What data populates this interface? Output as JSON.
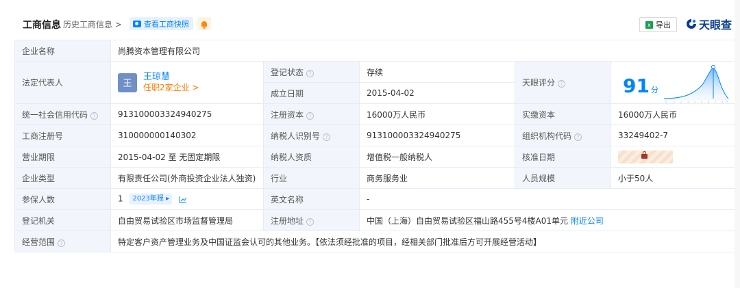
{
  "header": {
    "title": "工商信息",
    "history_link": "历史工商信息 >",
    "snapshot_button": "查看工商快照",
    "export_button": "导出",
    "brand": "天眼查"
  },
  "icons": {
    "snapshot": "camera-icon",
    "alert": "bell-icon",
    "export": "excel-icon",
    "brand": "tianyancha-logo-icon",
    "help": "question-circle-icon",
    "trend": "trend-chart-icon",
    "locked": "lock-icon"
  },
  "colors": {
    "accent": "#0084ff",
    "status_green": "#14a14e",
    "label_bg": "#f2f6fc",
    "orange": "#ff7a00"
  },
  "fields": {
    "company_name_label": "企业名称",
    "company_name": "尚腾资本管理有限公司",
    "legal_rep_label": "法定代表人",
    "legal_rep_avatar": "王",
    "legal_rep_name": "王琼慧",
    "legal_rep_jobs": "任职2家企业 >",
    "reg_status_label": "登记状态",
    "reg_status": "存续",
    "found_date_label": "成立日期",
    "found_date": "2015-04-02",
    "score_label": "天眼评分",
    "score_value": "91",
    "score_unit": "分",
    "credit_code_label": "统一社会信用代码",
    "credit_code": "913100003324940275",
    "reg_capital_label": "注册资本",
    "reg_capital": "16000万人民币",
    "paid_capital_label": "实缴资本",
    "paid_capital": "16000万人民币",
    "reg_no_label": "工商注册号",
    "reg_no": "310000000140302",
    "tax_id_label": "纳税人识别号",
    "tax_id": "913100003324940275",
    "org_code_label": "组织机构代码",
    "org_code": "33249402-7",
    "term_label": "营业期限",
    "term": "2015-04-02 至 无固定期限",
    "taxpayer_label": "纳税人资质",
    "taxpayer": "增值税一般纳税人",
    "approve_date_label": "核准日期",
    "type_label": "企业类型",
    "type": "有限责任公司(外商投资企业法人独资)",
    "industry_label": "行业",
    "industry": "商务服务业",
    "staff_label": "人员规模",
    "staff": "小于50人",
    "insured_label": "参保人数",
    "insured": "1",
    "insured_badge": "2023年报 ▸",
    "english_label": "英文名称",
    "english": "-",
    "authority_label": "登记机关",
    "authority": "自由贸易试验区市场监督管理局",
    "address_label": "注册地址",
    "address": "中国（上海）自由贸易试验区福山路455号4楼A01单元",
    "nearby_link": "附近公司",
    "scope_label": "经营范围",
    "scope": "特定客户资产管理业务及中国证监会认可的其他业务。【依法须经批准的项目，经相关部门批准后方可开展经营活动】"
  }
}
